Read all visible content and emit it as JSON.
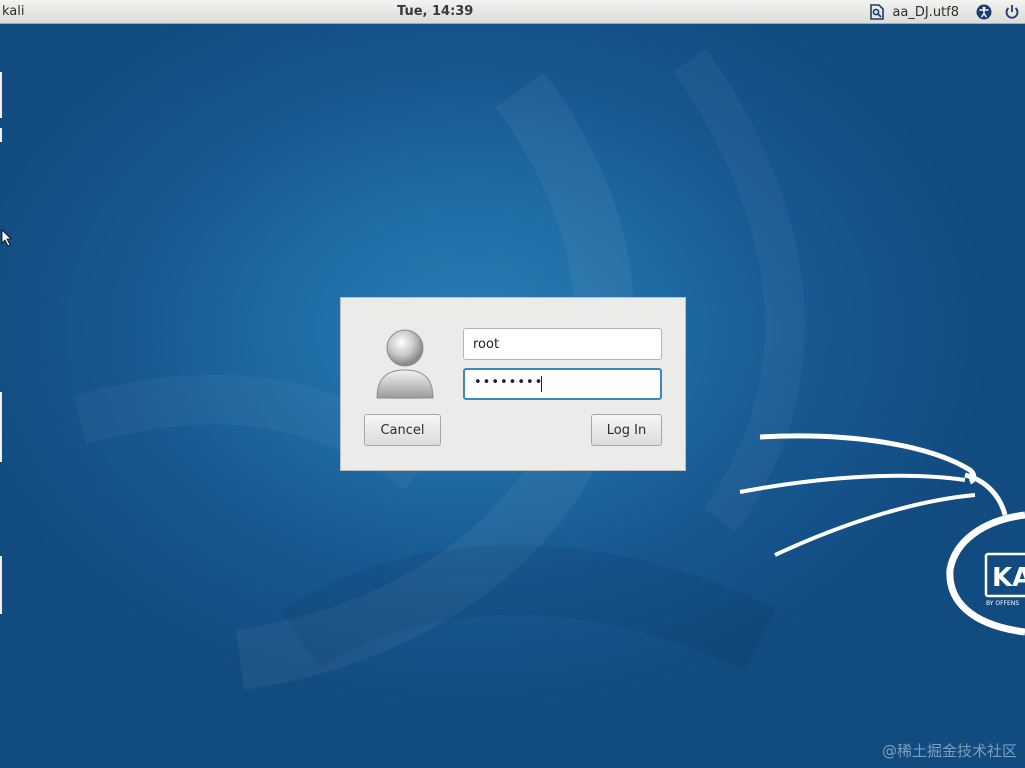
{
  "topbar": {
    "hostname": "kali",
    "clock": "Tue, 14:39",
    "keyboard_layout": "aa_DJ.utf8",
    "icons": [
      "keyboard-layout-icon",
      "accessibility-icon",
      "power-icon"
    ]
  },
  "login": {
    "username": "root",
    "password_masked": "••••••••",
    "cancel_label": "Cancel",
    "login_label": "Log In",
    "avatar_icon": "user-avatar-icon"
  },
  "logo": {
    "text": "KA",
    "subtext": "BY OFFENS"
  },
  "watermark": "@稀土掘金技术社区",
  "colors": {
    "wallpaper": "#1f6ca5",
    "focus_border": "#3b87c2",
    "dialog_bg": "#ebebea"
  }
}
